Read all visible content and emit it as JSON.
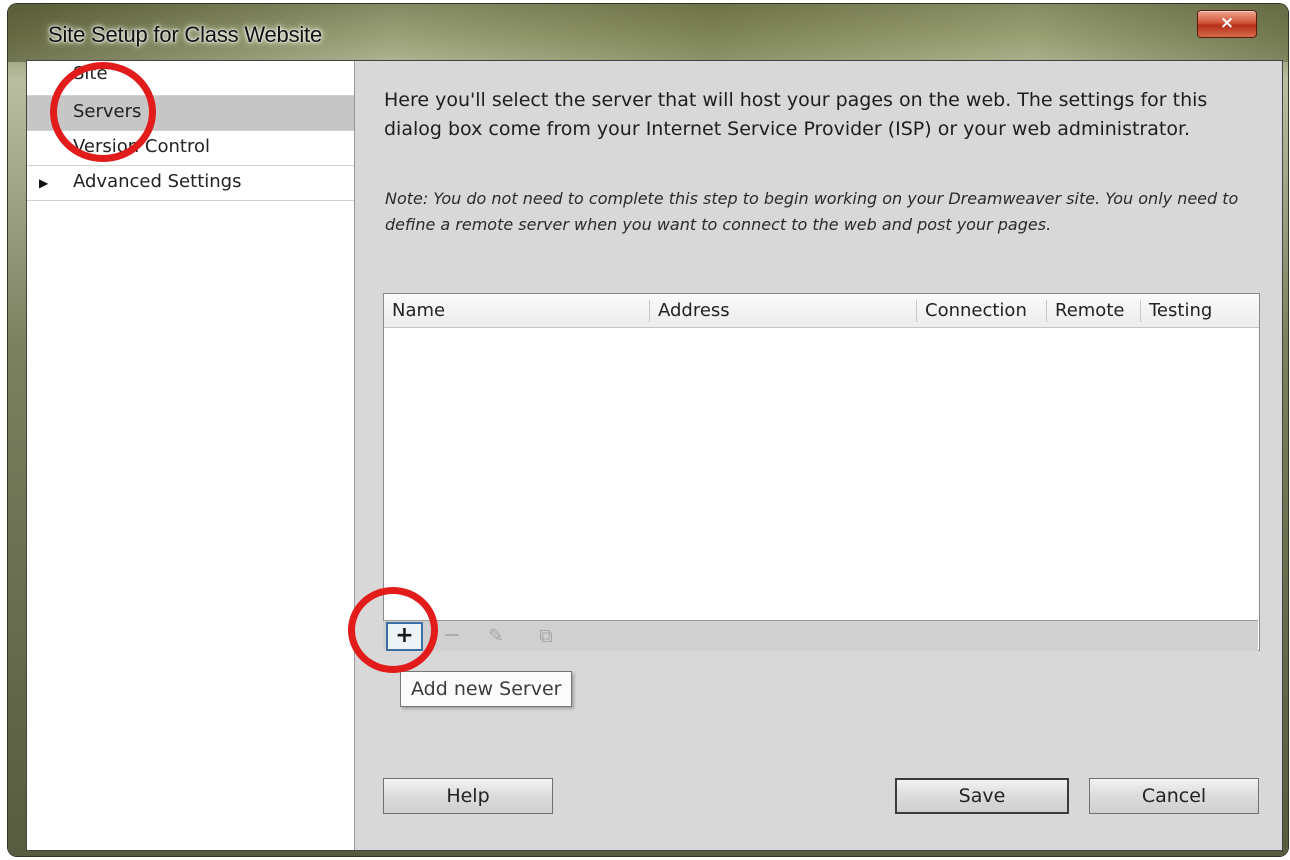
{
  "window": {
    "title": "Site Setup for Class Website",
    "close_label": "×"
  },
  "sidebar": {
    "items": [
      {
        "label": "Site"
      },
      {
        "label": "Servers",
        "selected": true
      },
      {
        "label": "Version Control"
      },
      {
        "label": "Advanced Settings",
        "expandable": true
      }
    ]
  },
  "main": {
    "intro": "Here you'll select the server that will host your pages on the web. The settings for this dialog box come from your Internet Service Provider (ISP) or your web administrator.",
    "note": "Note: You do not need to complete this step to begin working on your Dreamweaver site. You only need to define a remote server when you want to connect to the web and post your pages.",
    "table": {
      "columns": [
        "Name",
        "Address",
        "Connection",
        "Remote",
        "Testing"
      ],
      "rows": []
    },
    "toolbar": {
      "add_icon": "+",
      "remove_icon": "−",
      "edit_icon": "✎",
      "duplicate_icon": "⧉"
    },
    "tooltip": "Add new Server"
  },
  "buttons": {
    "help": "Help",
    "save": "Save",
    "cancel": "Cancel"
  },
  "colors": {
    "annotation_circle": "#e21b1b"
  }
}
